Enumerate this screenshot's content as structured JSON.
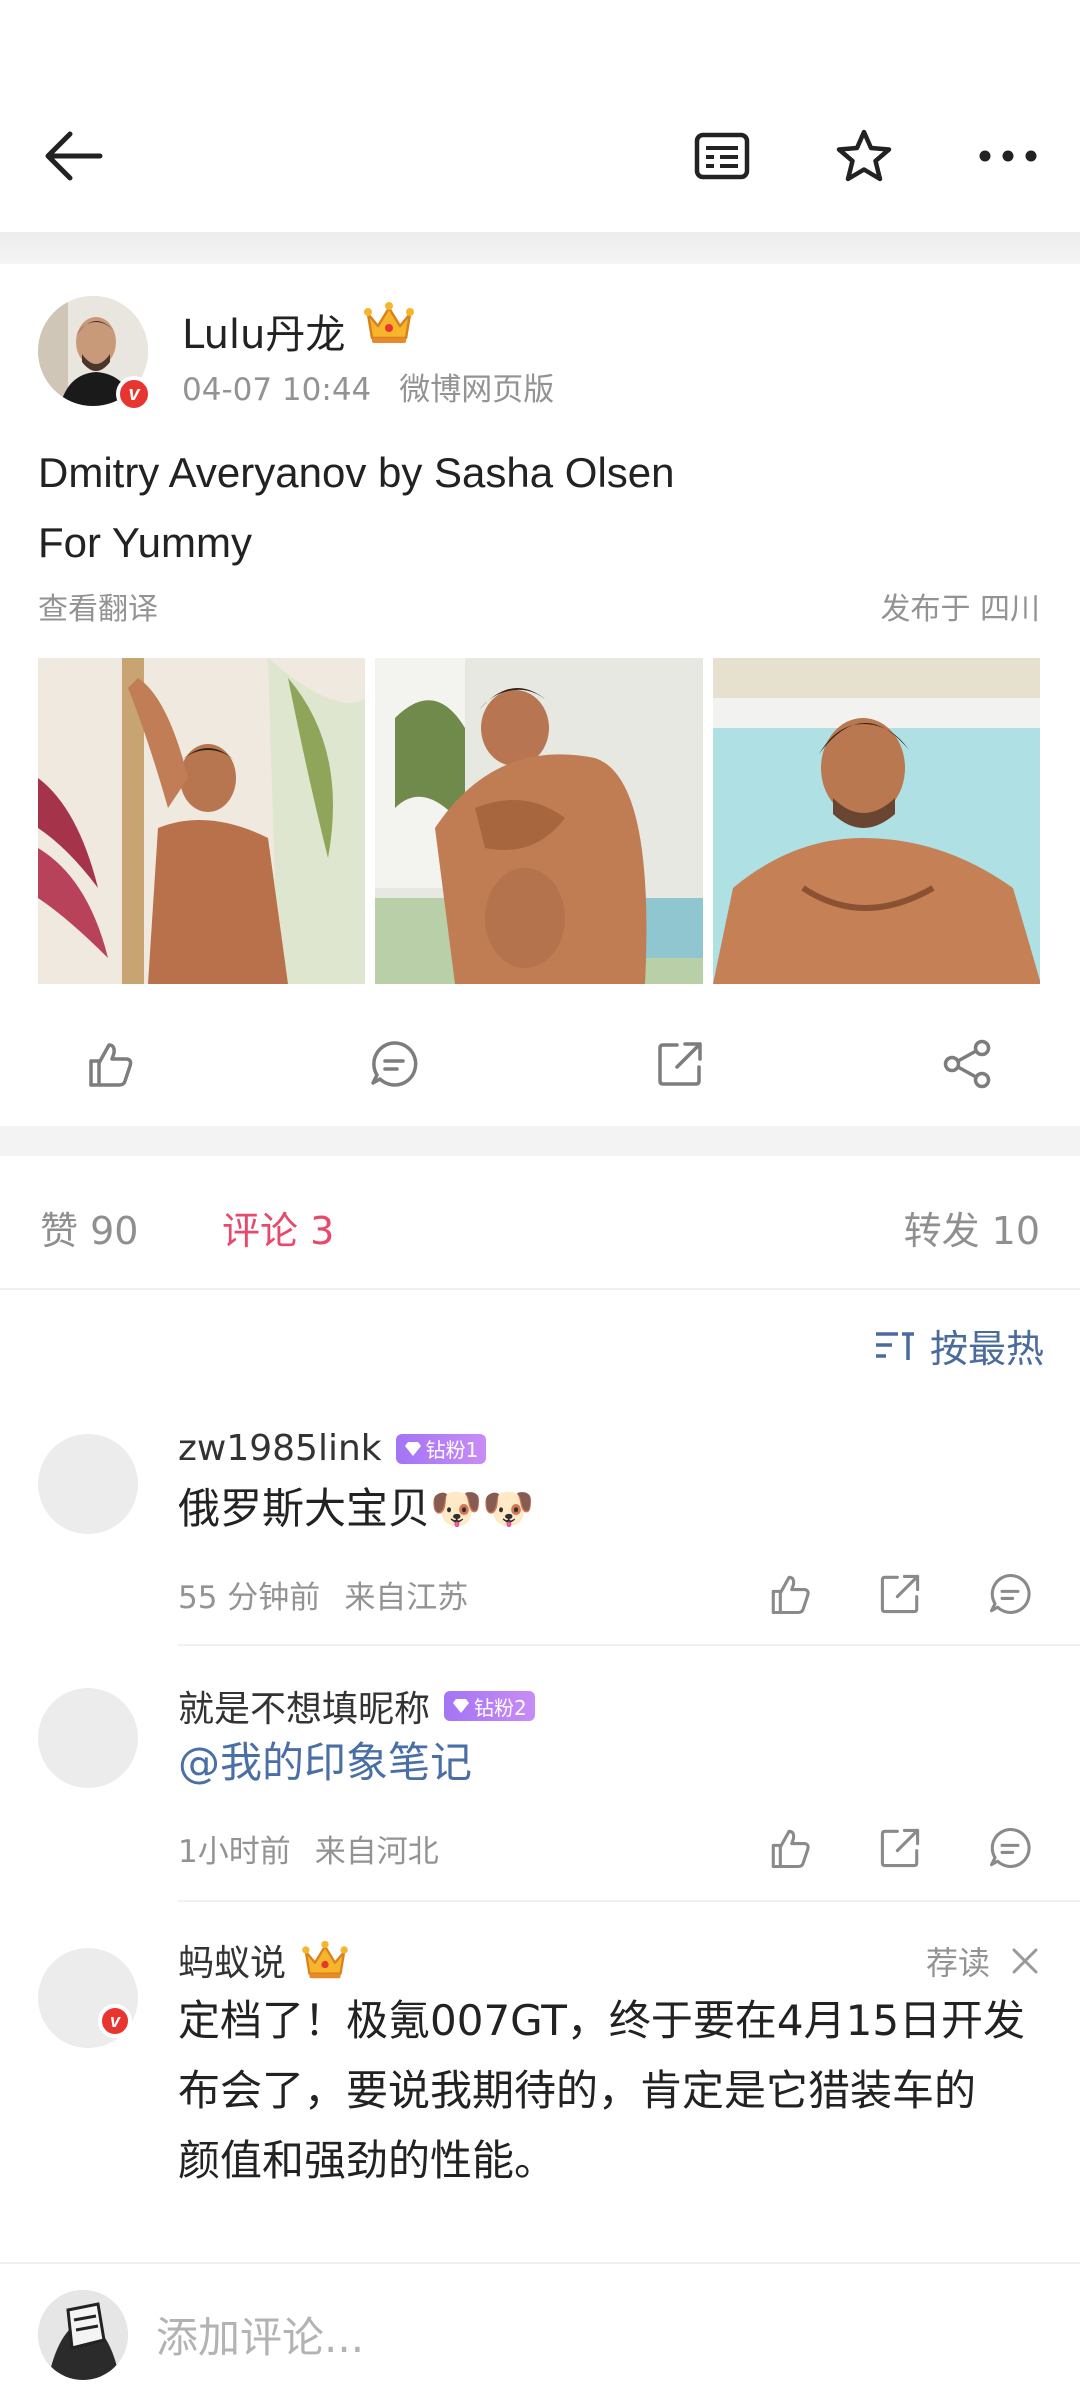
{
  "nav": {
    "back_icon": "back-arrow-icon",
    "icons": [
      "article-icon",
      "star-icon",
      "more-icon"
    ]
  },
  "post": {
    "author": "Lulu丹龙",
    "time": "04-07 10:44",
    "source": "微博网页版",
    "text_line1": "Dmitry Averyanov by Sasha Olsen",
    "text_line2": "For Yummy",
    "translate": "查看翻译",
    "location": "发布于 四川",
    "photo_count": 3
  },
  "stats": {
    "likes": "赞 90",
    "comments": "评论 3",
    "reposts": "转发 10"
  },
  "sort_label": "按最热",
  "comments": [
    {
      "name": "zw1985link",
      "badge": "钻粉1",
      "text": "俄罗斯大宝贝",
      "emoji": "🐶🐶",
      "time": "55 分钟前",
      "from": "来自江苏"
    },
    {
      "name": "就是不想填昵称",
      "badge": "钻粉2",
      "text": "@我的印象笔记",
      "time": "1小时前",
      "from": "来自河北"
    },
    {
      "name": "蚂蚁说",
      "recommend": "荐读",
      "text_line1": "定档了！极氪007GT，终于要在4月15日开发",
      "text_line2": "布会了，要说我期待的，肯定是它猎装车的",
      "text_line3": "颜值和强劲的性能。"
    }
  ],
  "bottom": {
    "placeholder": "添加评论..."
  },
  "colors": {
    "accent": "#e8496a",
    "link": "#4a6fa6",
    "meta": "#939393",
    "badge": "#a374f5",
    "verified": "#e8352f"
  }
}
